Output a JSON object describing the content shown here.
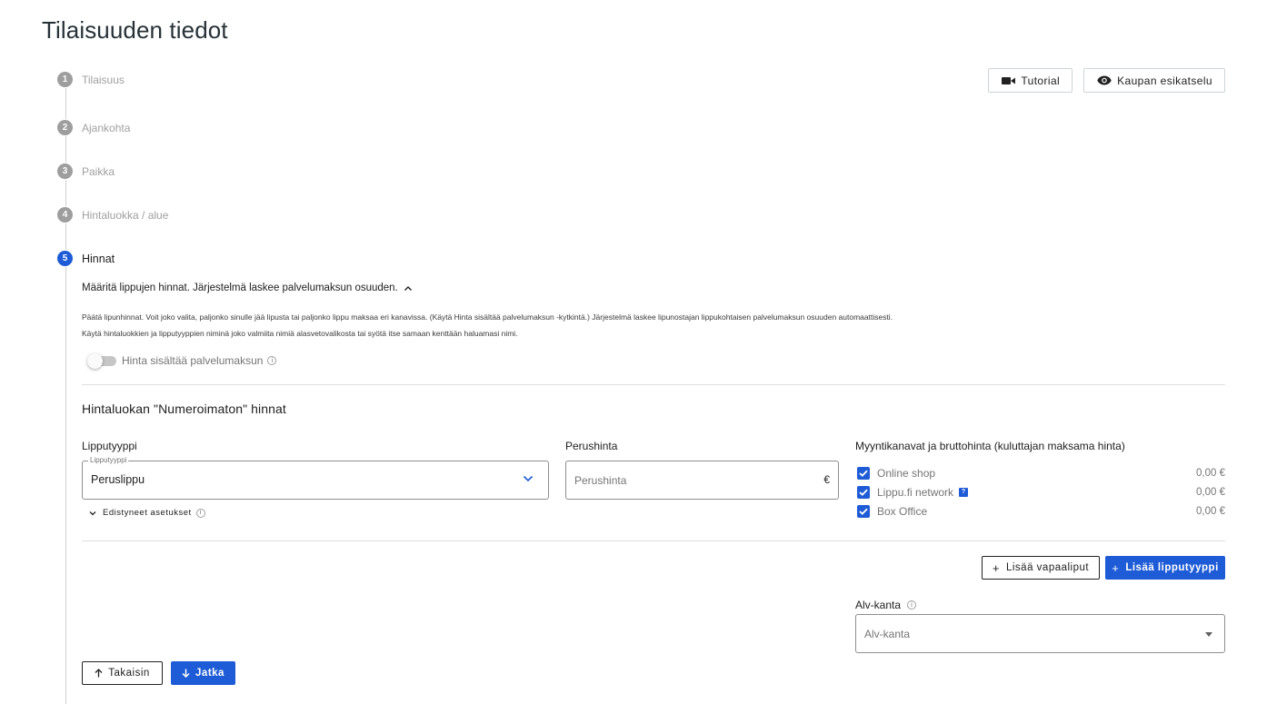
{
  "page_title": "Tilaisuuden tiedot",
  "header_actions": {
    "tutorial_label": "Tutorial",
    "preview_label": "Kaupan esikatselu"
  },
  "steps": [
    {
      "number": "1",
      "label": "Tilaisuus"
    },
    {
      "number": "2",
      "label": "Ajankohta"
    },
    {
      "number": "3",
      "label": "Paikka"
    },
    {
      "number": "4",
      "label": "Hintaluokka / alue"
    },
    {
      "number": "5",
      "label": "Hinnat"
    }
  ],
  "pricing": {
    "intro_toggle": "Määritä lippujen hinnat. Järjestelmä laskee palvelumaksun osuuden.",
    "description_line1": "Päätä lipunhinnat. Voit joko valita, paljonko sinulle jää lipusta tai paljonko lippu maksaa eri kanavissa. (Käytä Hinta sisältää palvelumaksun -kytkintä.) Järjestelmä laskee lipunostajan lippukohtaisen palvelumaksun osuuden automaattisesti.",
    "description_line2": "Käytä hintaluokkien ja lipputyyppien niminä joko valmiita nimiä alasvetovalikosta tai syötä itse samaan kenttään haluamasi nimi.",
    "switch_label": "Hinta sisältää palvelumaksun",
    "switch_on": false,
    "section_title": "Hintaluokan \"Numeroimaton\" hinnat",
    "ticket_type_label": "Lipputyyppi",
    "ticket_type_legend": "Lipputyyppi",
    "ticket_type_value": "Peruslippu",
    "base_price_label": "Perushinta",
    "base_price_placeholder": "Perushinta",
    "currency_suffix": "€",
    "advanced_settings": "Edistyneet asetukset",
    "channels_label": "Myyntikanavat ja bruttohinta (kuluttajan maksama hinta)",
    "channels": [
      {
        "name": "Online shop",
        "price": "0,00 €",
        "checked": true,
        "help": false
      },
      {
        "name": "Lippu.fi network",
        "price": "0,00 €",
        "checked": true,
        "help": true
      },
      {
        "name": "Box Office",
        "price": "0,00 €",
        "checked": true,
        "help": false
      }
    ],
    "add_free_tickets": "Lisää vapaaliput",
    "add_ticket_type": "Lisää lipputyyppi",
    "vat_label": "Alv-kanta",
    "vat_placeholder": "Alv-kanta"
  },
  "nav": {
    "back_label": "Takaisin",
    "continue_label": "Jatka"
  },
  "colors": {
    "primary": "#1e5bd6",
    "step_inactive": "#9e9e9e"
  }
}
